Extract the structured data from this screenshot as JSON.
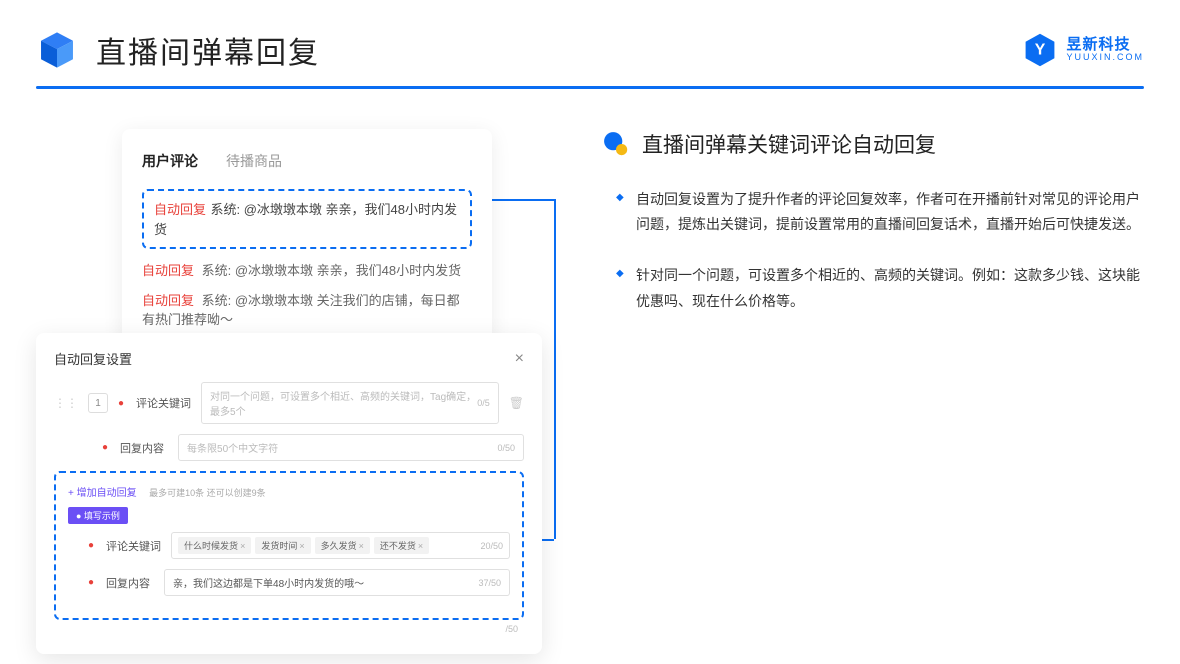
{
  "header": {
    "title": "直播间弹幕回复",
    "logo_cn": "昱新科技",
    "logo_en": "YUUXIN.COM"
  },
  "comment_card": {
    "tab_active": "用户评论",
    "tab_inactive": "待播商品",
    "auto_tag": "自动回复",
    "highlighted": "系统: @冰墩墩本墩 亲亲，我们48小时内发货",
    "row2": "系统: @冰墩墩本墩 亲亲，我们48小时内发货",
    "row3": "系统: @冰墩墩本墩 关注我们的店铺，每日都有热门推荐呦～"
  },
  "settings": {
    "title": "自动回复设置",
    "row_num": "1",
    "label_keyword": "评论关键词",
    "placeholder_keyword": "对同一个问题，可设置多个相近、高频的关键词，Tag确定，最多5个",
    "count_keyword": "0/5",
    "label_content": "回复内容",
    "placeholder_content": "每条限50个中文字符",
    "count_content": "0/50",
    "add_link": "+ 增加自动回复",
    "hint": "最多可建10条 还可以创建9条",
    "badge": "● 填写示例",
    "ex_label_keyword": "评论关键词",
    "ex_tags": [
      "什么时候发货",
      "发货时间",
      "多久发货",
      "还不发货"
    ],
    "ex_count_keyword": "20/50",
    "ex_label_content": "回复内容",
    "ex_content": "亲，我们这边都是下单48小时内发货的哦～",
    "ex_count_content": "37/50",
    "outer_count": "/50"
  },
  "right": {
    "section_title": "直播间弹幕关键词评论自动回复",
    "bullet1": "自动回复设置为了提升作者的评论回复效率，作者可在开播前针对常见的评论用户问题，提炼出关键词，提前设置常用的直播间回复话术，直播开始后可快捷发送。",
    "bullet2": "针对同一个问题，可设置多个相近的、高频的关键词。例如：这款多少钱、这块能优惠吗、现在什么价格等。"
  }
}
